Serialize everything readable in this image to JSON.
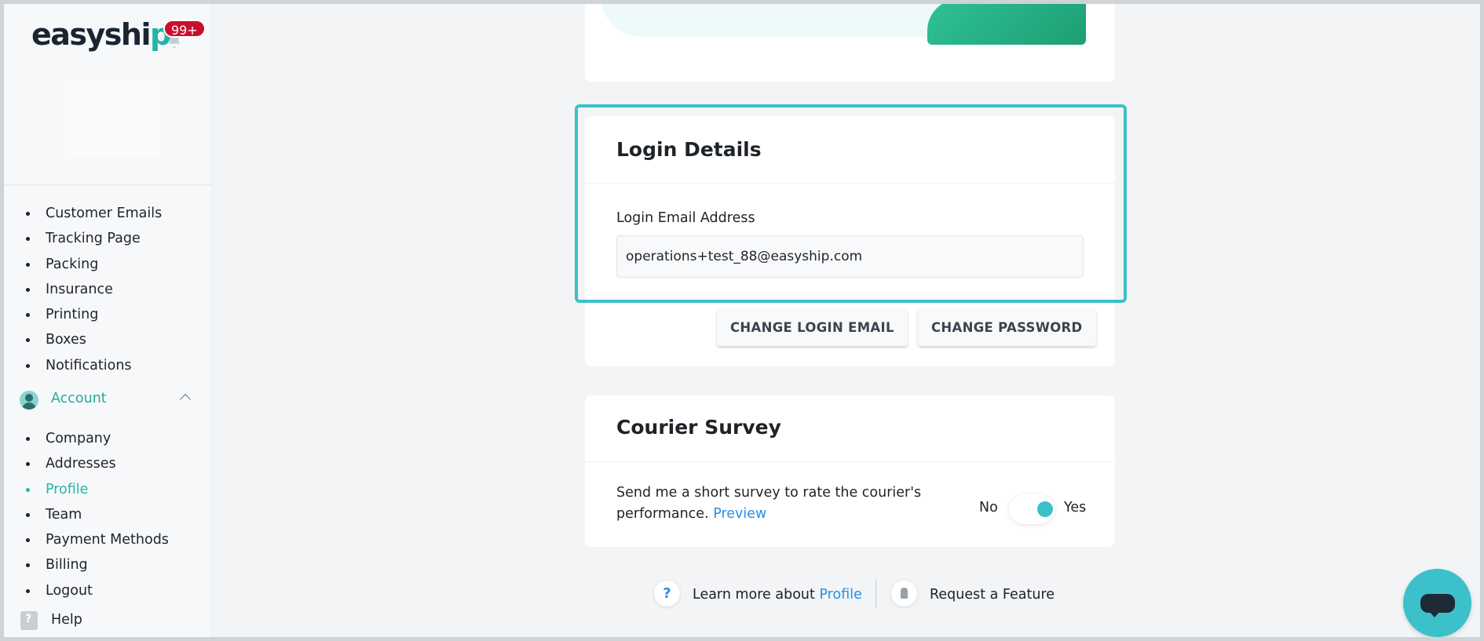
{
  "logo": {
    "text_main": "easyshi",
    "text_accent": "p"
  },
  "notifications": {
    "badge": "99+"
  },
  "sidebar": {
    "settings_items": [
      {
        "label": "Customer Emails"
      },
      {
        "label": "Tracking Page"
      },
      {
        "label": "Packing"
      },
      {
        "label": "Insurance"
      },
      {
        "label": "Printing"
      },
      {
        "label": "Boxes"
      },
      {
        "label": "Notifications"
      }
    ],
    "account_section": {
      "label": "Account",
      "expanded": true
    },
    "account_items": [
      {
        "label": "Company"
      },
      {
        "label": "Addresses"
      },
      {
        "label": "Profile",
        "active": true
      },
      {
        "label": "Team"
      },
      {
        "label": "Payment Methods"
      },
      {
        "label": "Billing"
      },
      {
        "label": "Logout"
      }
    ],
    "help_label": "Help"
  },
  "login_details": {
    "title": "Login Details",
    "email_label": "Login Email Address",
    "email_value": "operations+test_88@easyship.com",
    "change_email_label": "CHANGE LOGIN EMAIL",
    "change_password_label": "CHANGE PASSWORD"
  },
  "courier_survey": {
    "title": "Courier Survey",
    "description": "Send me a short survey to rate the courier's performance.",
    "preview_link": "Preview",
    "toggle_no": "No",
    "toggle_yes": "Yes",
    "toggle_on": true
  },
  "footer": {
    "learn_prefix": "Learn more about",
    "learn_link": "Profile",
    "request_feature": "Request a Feature"
  },
  "colors": {
    "accent": "#3cc0c9",
    "active_nav": "#26b6ac",
    "link": "#2d8ee6",
    "badge": "#c8102e"
  }
}
